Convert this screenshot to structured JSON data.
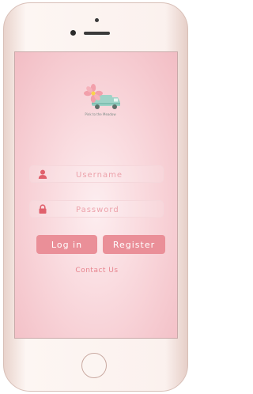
{
  "app": {
    "logo_caption": "Pink to the Meadow",
    "logo_name": "pink-flower-van-logo"
  },
  "login": {
    "username_placeholder": "Username",
    "password_placeholder": "Password",
    "username_icon": "user-icon",
    "password_icon": "lock-icon",
    "login_label": "Log in",
    "register_label": "Register",
    "contact_label": "Contact Us"
  },
  "colors": {
    "accent": "#ea8f98",
    "icon": "#e0606c",
    "screen_bg": "#f8d3d8"
  }
}
